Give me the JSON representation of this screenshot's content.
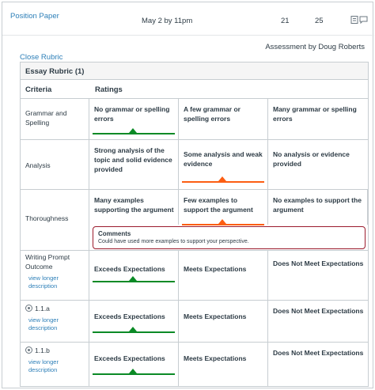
{
  "assignment": {
    "name": "Position Paper",
    "due": "May 2 by 11pm",
    "score": "21",
    "points_possible": "25",
    "icons": [
      "rubric-icon",
      "comments-icon"
    ]
  },
  "assessed_by": "Assessment by Doug Roberts",
  "close_rubric": "Close Rubric",
  "rubric": {
    "title": "Essay Rubric (1)",
    "headers": {
      "criteria": "Criteria",
      "ratings": "Ratings"
    },
    "view_longer": "view longer description",
    "criteria": [
      {
        "label": "Grammar and Spelling",
        "ratings": [
          "No grammar or spelling errors",
          "A few grammar or spelling errors",
          "Many grammar or spelling errors"
        ],
        "selected": 0,
        "selected_color": "#0b8a26"
      },
      {
        "label": "Analysis",
        "ratings": [
          "Strong analysis of the topic and solid evidence provided",
          "Some analysis and weak evidence",
          "No analysis or evidence provided"
        ],
        "selected": 1,
        "selected_color": "#fc5e13"
      },
      {
        "label": "Thoroughness",
        "ratings": [
          "Many examples supporting the argument",
          "Few examples to support the argument",
          "No examples to support the argument"
        ],
        "selected": 1,
        "selected_color": "#fc5e13",
        "comment_title": "Comments",
        "comment_text": "Could have used more examples to support your perspective."
      },
      {
        "label": "Writing Prompt Outcome",
        "ratings": [
          "Exceeds Expectations",
          "Meets Expectations",
          "Does Not Meet Expectations"
        ],
        "selected": 0,
        "selected_color": "#0b8a26"
      },
      {
        "label": "1.1.a",
        "outcome_icon": "outcome-icon",
        "ratings": [
          "Exceeds Expectations",
          "Meets Expectations",
          "Does Not Meet Expectations"
        ],
        "selected": 0,
        "selected_color": "#0b8a26"
      },
      {
        "label": "1.1.b",
        "outcome_icon": "outcome-icon",
        "ratings": [
          "Exceeds Expectations",
          "Meets Expectations",
          "Does Not Meet Expectations"
        ],
        "selected": 0,
        "selected_color": "#0b8a26"
      }
    ]
  }
}
